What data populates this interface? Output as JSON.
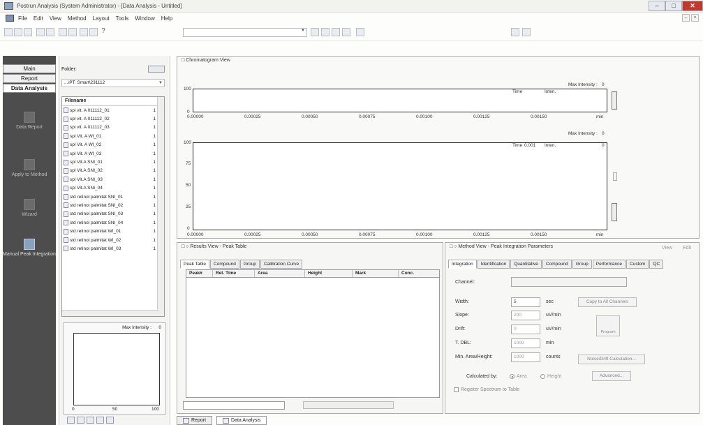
{
  "window": {
    "title": "Postrun Analysis (System Administrator) - [Data Analysis - Untitled]"
  },
  "menu": {
    "items": [
      "File",
      "Edit",
      "View",
      "Method",
      "Layout",
      "Tools",
      "Window",
      "Help"
    ]
  },
  "toolbar": {
    "help_glyph": "?"
  },
  "nav": {
    "tabs": [
      "Main",
      "Report",
      "Data Analysis"
    ],
    "active_tab": "Data Analysis",
    "items": [
      "Data Report",
      "Apply to Method",
      "Wizard",
      "Manual Peak Integration"
    ],
    "active_item": "Manual Peak Integration"
  },
  "folder": {
    "label": "Folder:",
    "path": "...\\PT. Smart\\231112"
  },
  "files": {
    "header": "Filename",
    "rows": [
      {
        "name": "spl vit. A 011112_01",
        "n": "1"
      },
      {
        "name": "spl vit. A 011112_02",
        "n": "1"
      },
      {
        "name": "spl vit. A 011112_03",
        "n": "1"
      },
      {
        "name": "spl Vit. A WI_01",
        "n": "1"
      },
      {
        "name": "spl Vit. A WI_02",
        "n": "1"
      },
      {
        "name": "spl Vit. A WI_03",
        "n": "1"
      },
      {
        "name": "spl Vit.A SNI_01",
        "n": "1"
      },
      {
        "name": "spl Vit.A SNI_02",
        "n": "1"
      },
      {
        "name": "spl Vit.A SNI_03",
        "n": "1"
      },
      {
        "name": "spl Vit.A SNI_04",
        "n": "1"
      },
      {
        "name": "std retinol palmitat SNI_01",
        "n": "1"
      },
      {
        "name": "std retinol palmitat SNI_02",
        "n": "1"
      },
      {
        "name": "std retinol palmitat SNI_03",
        "n": "1"
      },
      {
        "name": "std retinol palmitat SNI_04",
        "n": "1"
      },
      {
        "name": "std retinol palmitat WI_01",
        "n": "1"
      },
      {
        "name": "std retinol palmitat WI_02",
        "n": "1"
      },
      {
        "name": "std retinol palmitat WI_03",
        "n": "1"
      }
    ]
  },
  "mini": {
    "label": "Max Intensity :",
    "value": "0",
    "x_ticks": [
      "0",
      "50",
      "100"
    ]
  },
  "chrom": {
    "title": "Chromatogram View",
    "plot1": {
      "y_top": "100",
      "y_bottom": "0",
      "max_label": "Max Intensity :",
      "max_value": "0",
      "time_label": "Time",
      "time_value": "",
      "unit_label": "Inten.",
      "unit_value": ""
    },
    "plot2": {
      "y_ticks": [
        "100",
        "75",
        "50",
        "25",
        "0"
      ],
      "max_label": "Max Intensity :",
      "max_value": "0",
      "time_label": "Time",
      "time_value": "0.001",
      "unit_label": "Inten.",
      "unit_value": "0"
    },
    "x_ticks": [
      "0.00000",
      "0.00025",
      "0.00050",
      "0.00075",
      "0.00100",
      "0.00125",
      "0.00150"
    ],
    "x_unit": "min"
  },
  "results": {
    "title": "Results View - Peak Table",
    "tabs": [
      "Peak Table",
      "Compound",
      "Group",
      "Calibration Curve"
    ],
    "active_tab": "Peak Table",
    "columns": [
      "Peak#",
      "Ret. Time",
      "Area",
      "Height",
      "Mark",
      "Conc."
    ]
  },
  "method": {
    "title": "Method View - Peak Integration Parameters",
    "view_label": "View",
    "edit_label": "Edit",
    "tabs": [
      "Integration",
      "Identification",
      "Quantitative",
      "Compound",
      "Group",
      "Performance",
      "Custom",
      "QC"
    ],
    "active_tab": "Integration",
    "channel_label": "Channel:",
    "channel_value": "",
    "width_label": "Width:",
    "width_value": "5",
    "width_unit": "sec",
    "slope_label": "Slope:",
    "slope_value": "200",
    "slope_unit": "uV/min",
    "drift_label": "Drift:",
    "drift_value": "0",
    "drift_unit": "uV/min",
    "tdbl_label": "T. DBL:",
    "tdbl_value": "1000",
    "tdbl_unit": "min",
    "minarea_label": "Min. Area/Height:",
    "minarea_value": "1000",
    "minarea_unit": "counts",
    "copy_button": "Copy to All Channels",
    "program_button": "Program",
    "noise_button": "Noise/Drift Calculation...",
    "advanced_button": "Advanced...",
    "calc_label": "Calculated by:",
    "calc_area": "Area",
    "calc_height": "Height",
    "register_label": "Register Spectrum to Table"
  },
  "bottom": {
    "tabs": [
      "Report",
      "Data Analysis"
    ],
    "active_tab": "Data Analysis"
  },
  "colors": {
    "nav_bg": "#4d4d4d",
    "accent": "#8aa0c0"
  }
}
